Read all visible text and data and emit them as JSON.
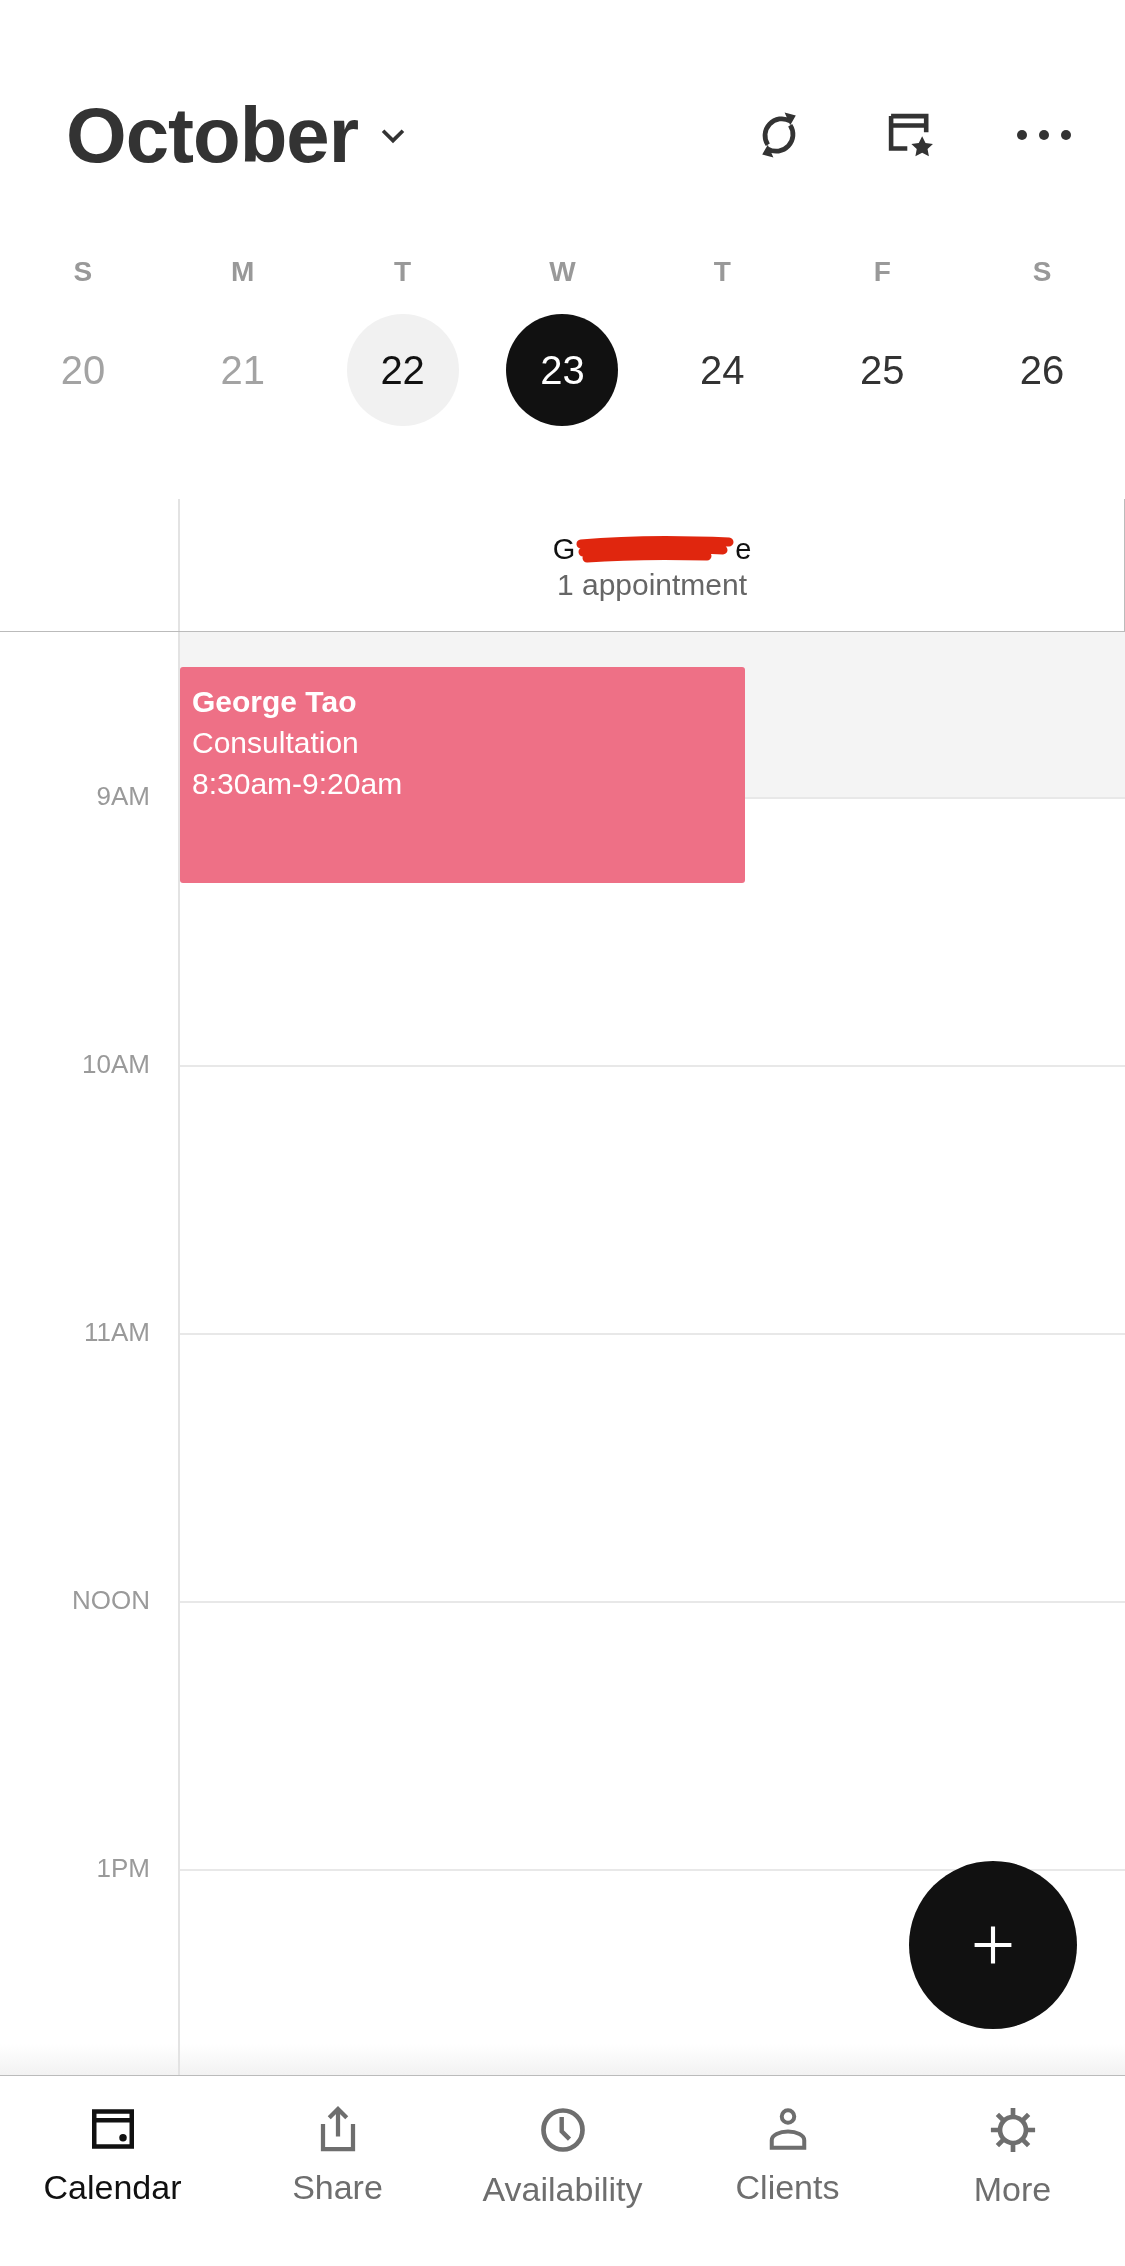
{
  "header": {
    "month": "October"
  },
  "week": [
    {
      "weekday": "S",
      "day": "20",
      "past": true,
      "today": false,
      "selected": false
    },
    {
      "weekday": "M",
      "day": "21",
      "past": true,
      "today": false,
      "selected": false
    },
    {
      "weekday": "T",
      "day": "22",
      "past": false,
      "today": true,
      "selected": false
    },
    {
      "weekday": "W",
      "day": "23",
      "past": false,
      "today": false,
      "selected": true
    },
    {
      "weekday": "T",
      "day": "24",
      "past": false,
      "today": false,
      "selected": false
    },
    {
      "weekday": "F",
      "day": "25",
      "past": false,
      "today": false,
      "selected": false
    },
    {
      "weekday": "S",
      "day": "26",
      "past": false,
      "today": false,
      "selected": false
    }
  ],
  "staff": {
    "name_start": "G",
    "name_end": "e",
    "count": "1 appointment"
  },
  "timeline": {
    "hours": [
      "9AM",
      "10AM",
      "11AM",
      "NOON",
      "1PM"
    ]
  },
  "appointment": {
    "client": "George Tao",
    "service": "Consultation",
    "time": "8:30am-9:20am",
    "color": "#ee7086"
  },
  "tabs": [
    {
      "label": "Calendar",
      "kind": "calendar",
      "selected": true
    },
    {
      "label": "Share",
      "kind": "share",
      "selected": false
    },
    {
      "label": "Availability",
      "kind": "clock",
      "selected": false
    },
    {
      "label": "Clients",
      "kind": "person",
      "selected": false
    },
    {
      "label": "More",
      "kind": "gear",
      "selected": false
    }
  ]
}
